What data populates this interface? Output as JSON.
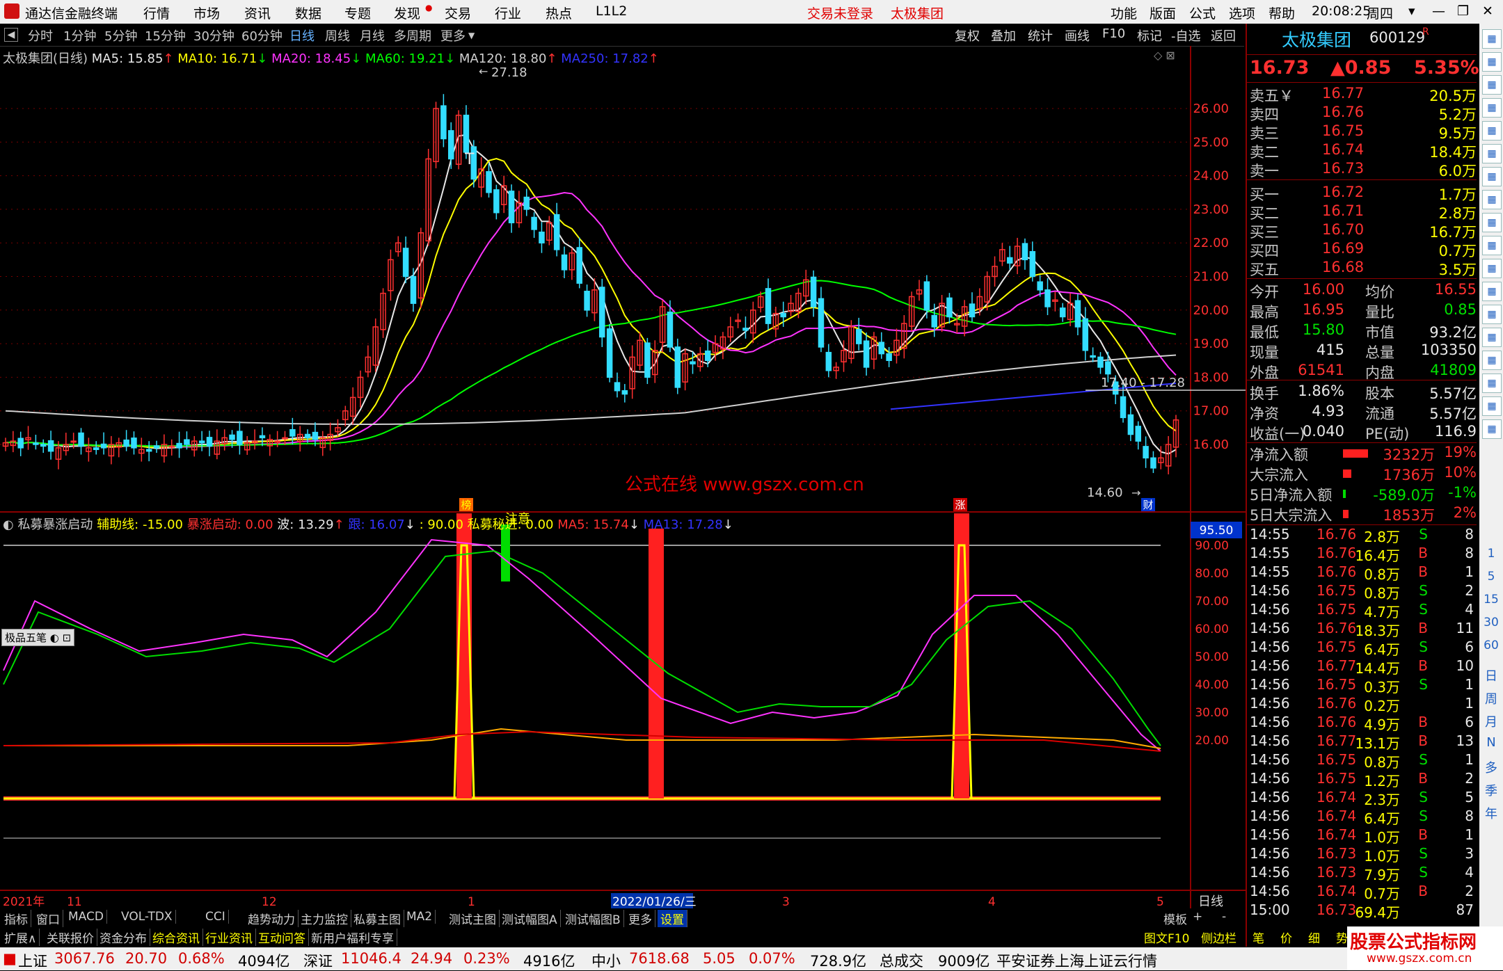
{
  "titlebar": {
    "app_name": "通达信金融终端",
    "menus": [
      "行情",
      "市场",
      "资讯",
      "数据",
      "专题",
      "发现",
      "交易",
      "行业",
      "热点",
      "L1L2"
    ],
    "login_status": "交易未登录",
    "stock_title": "太极集团",
    "right_menus": [
      "功能",
      "版面",
      "公式",
      "选项",
      "帮助"
    ],
    "time": "20:08:25",
    "weekday": "周四"
  },
  "periods": [
    "分时",
    "1分钟",
    "5分钟",
    "15分钟",
    "30分钟",
    "60分钟",
    "日线",
    "周线",
    "月线",
    "多周期",
    "更多"
  ],
  "active_period": "日线",
  "right_tools": [
    "复权",
    "叠加",
    "统计",
    "画线",
    "F10",
    "标记",
    "-自选",
    "返回"
  ],
  "main_chart": {
    "title": "太极集团(日线)",
    "indicators": [
      {
        "label": "MA5: 15.85",
        "color": "#e8e8e8",
        "arrow": "↑",
        "arrow_color": "#ff3030"
      },
      {
        "label": "MA10: 16.71",
        "color": "#ffff00",
        "arrow": "↓",
        "arrow_color": "#00e000"
      },
      {
        "label": "MA20: 18.45",
        "color": "#ff33ff",
        "arrow": "↓",
        "arrow_color": "#00e000"
      },
      {
        "label": "MA60: 19.21",
        "color": "#00ff00",
        "arrow": "↓",
        "arrow_color": "#00e000"
      },
      {
        "label": "MA120: 18.80",
        "color": "#d0d0d0",
        "arrow": "↑",
        "arrow_color": "#ff3030"
      },
      {
        "label": "MA250: 17.82",
        "color": "#3333ff",
        "arrow": "↑",
        "arrow_color": "#ff3030"
      }
    ],
    "price_ticks": [
      "26.00",
      "25.00",
      "24.00",
      "23.00",
      "22.00",
      "21.00",
      "20.00",
      "19.00",
      "18.00",
      "17.00",
      "16.00"
    ],
    "high_label": "27.18",
    "low_label": "14.60",
    "range_label": "17.40 - 17.28",
    "marker_t": "T",
    "marker_bang": "榜",
    "marker_zhang": "涨",
    "marker_cai": "财",
    "watermark": "公式在线  www.gszx.com.cn"
  },
  "sub_chart": {
    "title": "私募暴涨启动",
    "indicators": [
      {
        "label": "辅助线: -15.00",
        "color": "#ffff00"
      },
      {
        "label": "暴涨启动: 0.00",
        "color": "#ff3030"
      },
      {
        "label": "波: 13.29",
        "color": "#e8e8e8",
        "arrow": "↑",
        "arrow_color": "#ff3030"
      },
      {
        "label": "跟: 16.07",
        "color": "#3333ff",
        "arrow": "↓",
        "arrow_color": "#e8e8e8"
      },
      {
        "label": ": 90.00",
        "color": "#ffff00"
      },
      {
        "label": "私募秘进: 0.00",
        "color": "#ffff00"
      },
      {
        "label": "MA5: 15.74",
        "color": "#ff3030",
        "arrow": "↓",
        "arrow_color": "#e8e8e8"
      },
      {
        "label": "MA13: 17.28",
        "color": "#3333ff",
        "arrow": "↓",
        "arrow_color": "#e8e8e8"
      }
    ],
    "ticks": [
      "90.00",
      "80.00",
      "70.00",
      "60.00",
      "50.00",
      "40.00",
      "30.00",
      "20.00"
    ],
    "current_value": "95.50",
    "note_label": "注意",
    "toolbox_label": "极品五笔"
  },
  "xaxis": {
    "labels": [
      "2021年",
      "11",
      "12",
      "1",
      "2022/01/26/三",
      "3",
      "4",
      "5"
    ],
    "period_label": "日线"
  },
  "tabs_row1": [
    "指标",
    "窗口",
    "MACD",
    "VOL-TDX",
    "CCI",
    "趋势动力",
    "主力监控",
    "私募主图",
    "MA2",
    "测试主图",
    "测试幅图A",
    "测试幅图B",
    "更多",
    "设置"
  ],
  "tabs_row1_right": [
    "模板",
    "+",
    "-"
  ],
  "tabs_row2": [
    "扩展∧",
    "关联报价",
    "资金分布",
    "综合资讯",
    "行业资讯",
    "互动问答",
    "新用户福利专享"
  ],
  "tabs_row2_right": [
    "图文F10",
    "侧边栏《",
    "笔",
    "价",
    "细",
    "势"
  ],
  "quote": {
    "name": "太极集团",
    "code": "600129",
    "flag": "R",
    "price": "16.73",
    "change": "▲0.85",
    "pct": "5.35%",
    "asks": [
      {
        "label": "卖五￥",
        "price": "16.77",
        "vol": "20.5万"
      },
      {
        "label": "卖四",
        "price": "16.76",
        "vol": "5.2万"
      },
      {
        "label": "卖三",
        "price": "16.75",
        "vol": "9.5万"
      },
      {
        "label": "卖二",
        "price": "16.74",
        "vol": "18.4万"
      },
      {
        "label": "卖一",
        "price": "16.73",
        "vol": "6.0万"
      }
    ],
    "bids": [
      {
        "label": "买一",
        "price": "16.72",
        "vol": "1.7万"
      },
      {
        "label": "买二",
        "price": "16.71",
        "vol": "2.8万"
      },
      {
        "label": "买三",
        "price": "16.70",
        "vol": "16.7万"
      },
      {
        "label": "买四",
        "price": "16.69",
        "vol": "0.7万"
      },
      {
        "label": "买五",
        "price": "16.68",
        "vol": "3.5万"
      }
    ],
    "stats": [
      {
        "l1": "今开",
        "v1": "16.00",
        "c1": "red",
        "l2": "均价",
        "v2": "16.55",
        "c2": "red"
      },
      {
        "l1": "最高",
        "v1": "16.95",
        "c1": "red",
        "l2": "量比",
        "v2": "0.85",
        "c2": "green"
      },
      {
        "l1": "最低",
        "v1": "15.80",
        "c1": "green",
        "l2": "市值",
        "v2": "93.2亿",
        "c2": "white"
      },
      {
        "l1": "现量",
        "v1": "415",
        "c1": "white",
        "l2": "总量",
        "v2": "103350",
        "c2": "white"
      },
      {
        "l1": "外盘",
        "v1": "61541",
        "c1": "red",
        "l2": "内盘",
        "v2": "41809",
        "c2": "green"
      }
    ],
    "stats2": [
      {
        "l1": "换手",
        "v1": "1.86%",
        "l2": "股本",
        "v2": "5.57亿"
      },
      {
        "l1": "净资",
        "v1": "4.93",
        "l2": "流通",
        "v2": "5.57亿"
      },
      {
        "l1": "收益(一)",
        "v1": "0.040",
        "l2": "PE(动)",
        "v2": "116.9"
      }
    ],
    "flows": [
      {
        "label": "净流入额",
        "val": "3232万",
        "pct": "19%",
        "color": "red",
        "bar": 60
      },
      {
        "label": "大宗流入",
        "val": "1736万",
        "pct": "10%",
        "color": "red",
        "bar": 20
      },
      {
        "label": "5日净流入额",
        "val": "-589.0万",
        "pct": "-1%",
        "color": "green",
        "bar": 6
      },
      {
        "label": "5日大宗流入",
        "val": "1853万",
        "pct": "2%",
        "color": "red",
        "bar": 14
      }
    ],
    "ticks": [
      {
        "t": "14:55",
        "p": "16.76",
        "v": "2.8万",
        "s": "S",
        "n": "8"
      },
      {
        "t": "14:55",
        "p": "16.76",
        "v": "16.4万",
        "s": "B",
        "n": "8"
      },
      {
        "t": "14:55",
        "p": "16.76",
        "v": "0.8万",
        "s": "B",
        "n": "1"
      },
      {
        "t": "14:56",
        "p": "16.75",
        "v": "0.8万",
        "s": "S",
        "n": "2"
      },
      {
        "t": "14:56",
        "p": "16.75",
        "v": "4.7万",
        "s": "S",
        "n": "4"
      },
      {
        "t": "14:56",
        "p": "16.76",
        "v": "18.3万",
        "s": "B",
        "n": "11"
      },
      {
        "t": "14:56",
        "p": "16.75",
        "v": "6.4万",
        "s": "S",
        "n": "6"
      },
      {
        "t": "14:56",
        "p": "16.77",
        "v": "14.4万",
        "s": "B",
        "n": "10"
      },
      {
        "t": "14:56",
        "p": "16.75",
        "v": "0.3万",
        "s": "S",
        "n": "1"
      },
      {
        "t": "14:56",
        "p": "16.76",
        "v": "0.2万",
        "s": "",
        "n": "1"
      },
      {
        "t": "14:56",
        "p": "16.76",
        "v": "4.9万",
        "s": "B",
        "n": "6"
      },
      {
        "t": "14:56",
        "p": "16.77",
        "v": "13.1万",
        "s": "B",
        "n": "13"
      },
      {
        "t": "14:56",
        "p": "16.75",
        "v": "0.8万",
        "s": "S",
        "n": "1"
      },
      {
        "t": "14:56",
        "p": "16.75",
        "v": "1.2万",
        "s": "B",
        "n": "2"
      },
      {
        "t": "14:56",
        "p": "16.74",
        "v": "2.3万",
        "s": "S",
        "n": "5"
      },
      {
        "t": "14:56",
        "p": "16.74",
        "v": "6.4万",
        "s": "S",
        "n": "8"
      },
      {
        "t": "14:56",
        "p": "16.74",
        "v": "1.0万",
        "s": "B",
        "n": "1"
      },
      {
        "t": "14:56",
        "p": "16.73",
        "v": "1.0万",
        "s": "S",
        "n": "3"
      },
      {
        "t": "14:56",
        "p": "16.73",
        "v": "7.9万",
        "s": "S",
        "n": "4"
      },
      {
        "t": "14:56",
        "p": "16.74",
        "v": "0.7万",
        "s": "B",
        "n": "2"
      },
      {
        "t": "15:00",
        "p": "16.73",
        "v": "69.4万",
        "s": "",
        "n": "87"
      }
    ]
  },
  "side_icons": [
    "日",
    "周",
    "月",
    "N",
    "多",
    "季",
    "年"
  ],
  "side_numbers": [
    "1",
    "5",
    "15",
    "30",
    "60"
  ],
  "statusbar": {
    "sh_label": "上证",
    "sh_val": "3067.76",
    "sh_chg": "20.70",
    "sh_pct": "0.68%",
    "sh_amt": "4094亿",
    "sz_label": "深证",
    "sz_val": "11046.4",
    "sz_chg": "24.94",
    "sz_pct": "0.23%",
    "sz_amt": "4916亿",
    "zx_label": "中小",
    "zx_val": "7618.68",
    "zx_chg": "5.05",
    "zx_pct": "0.07%",
    "zx_amt": "728.9亿",
    "total_label": "总成交",
    "total_val": "9009亿",
    "server": "平安证券上海上证云行情",
    "brand": "股票公式指标网",
    "brand_url": "www.gszx.com.cn"
  }
}
